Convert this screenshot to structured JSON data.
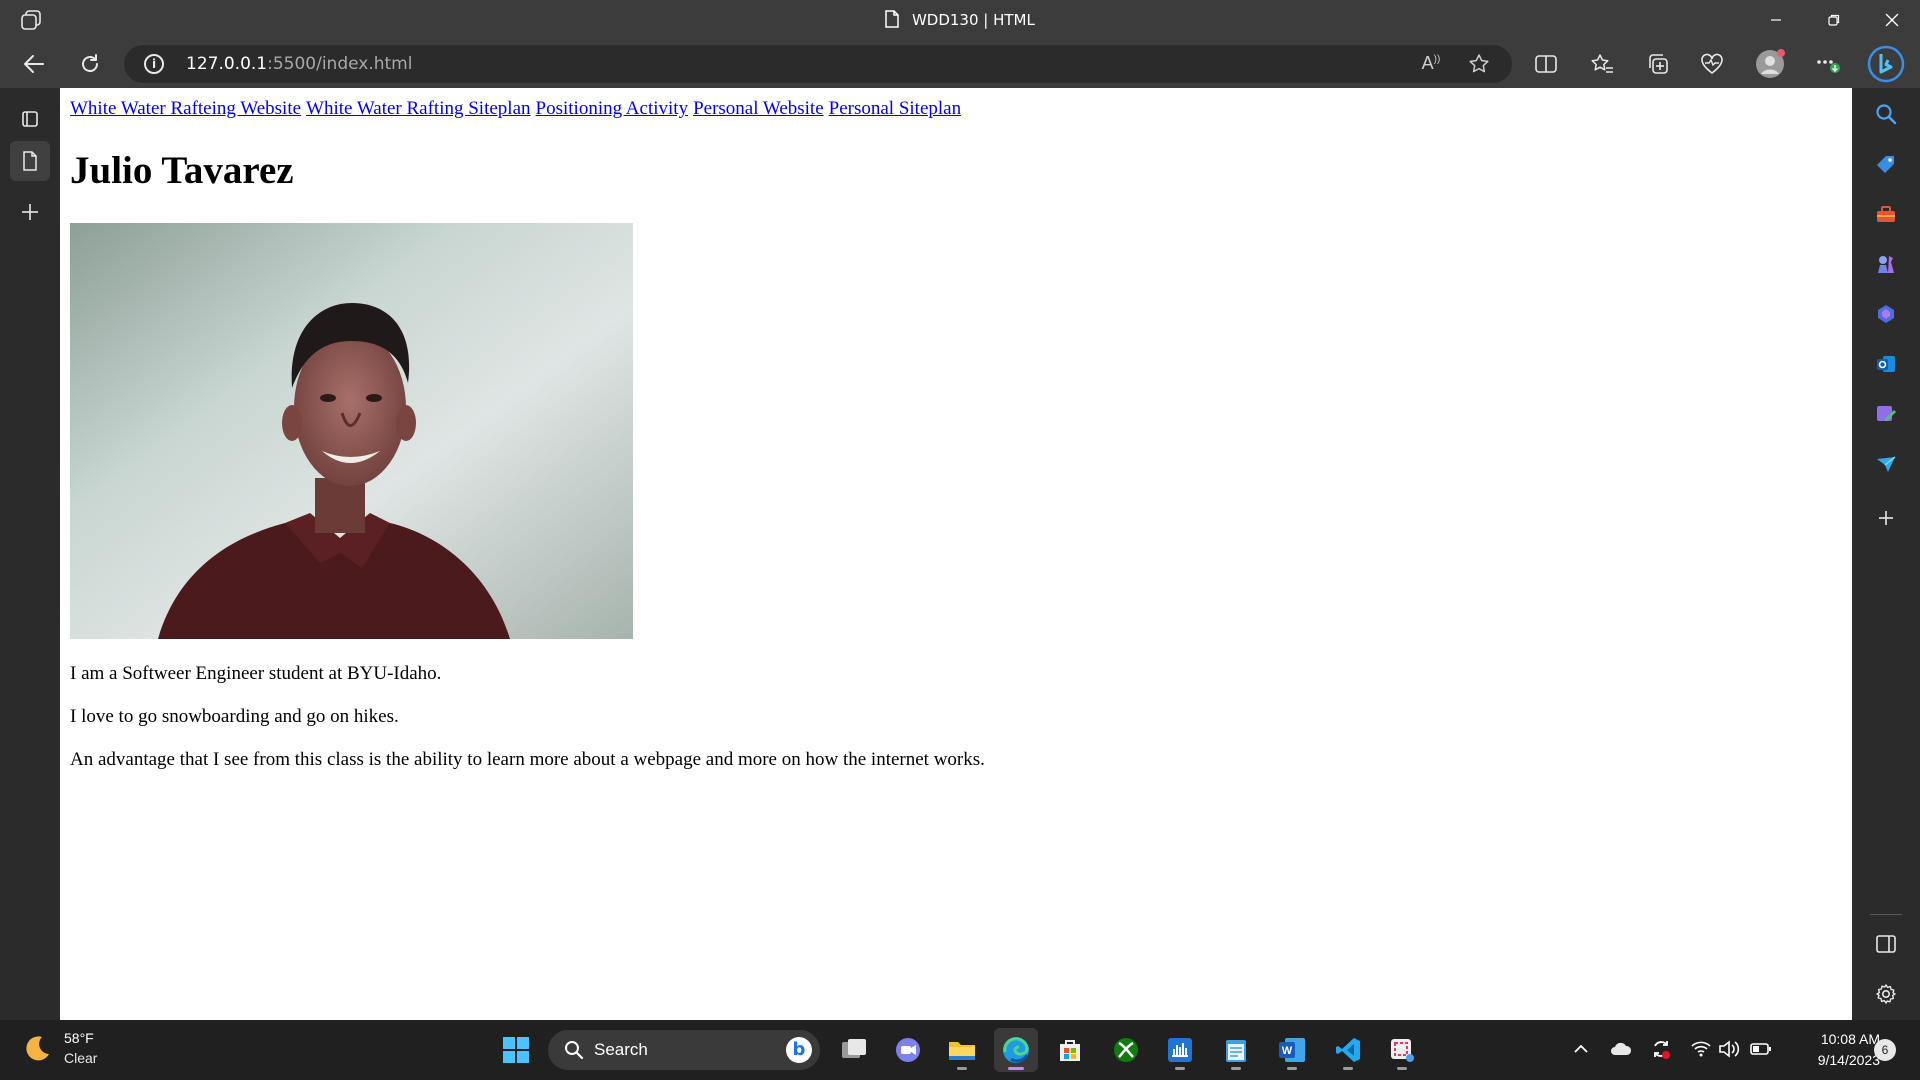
{
  "window": {
    "title": "WDD130 | HTML",
    "controls": [
      "minimize",
      "restore",
      "close"
    ]
  },
  "address_bar": {
    "host": "127.0.0.1",
    "path": ":5500/index.html"
  },
  "page": {
    "nav_links": [
      "White Water Rafteing Website",
      "White Water Rafting Siteplan",
      "Positioning Activity",
      "Personal Website",
      "Personal Siteplan"
    ],
    "heading": "Julio Tavarez",
    "photo_alt_subject": "portrait photo",
    "paragraphs": [
      "I am a Softweer Engineer student at BYU-Idaho.",
      "I love to go snowboarding and go on hikes.",
      "An advantage that I see from this class is the ability to learn more about a webpage and more on how the internet works."
    ],
    "link_color": "#0000ee"
  },
  "taskbar": {
    "weather": {
      "temp": "58°F",
      "condition": "Clear"
    },
    "search_label": "Search",
    "time": "10:08 AM",
    "date": "9/14/2023",
    "notification_count": "6"
  },
  "colors": {
    "chrome": "#3c3c3c",
    "frame": "#2b2b2b",
    "taskbar": "#202020",
    "edge_accent": "#c58af9"
  }
}
